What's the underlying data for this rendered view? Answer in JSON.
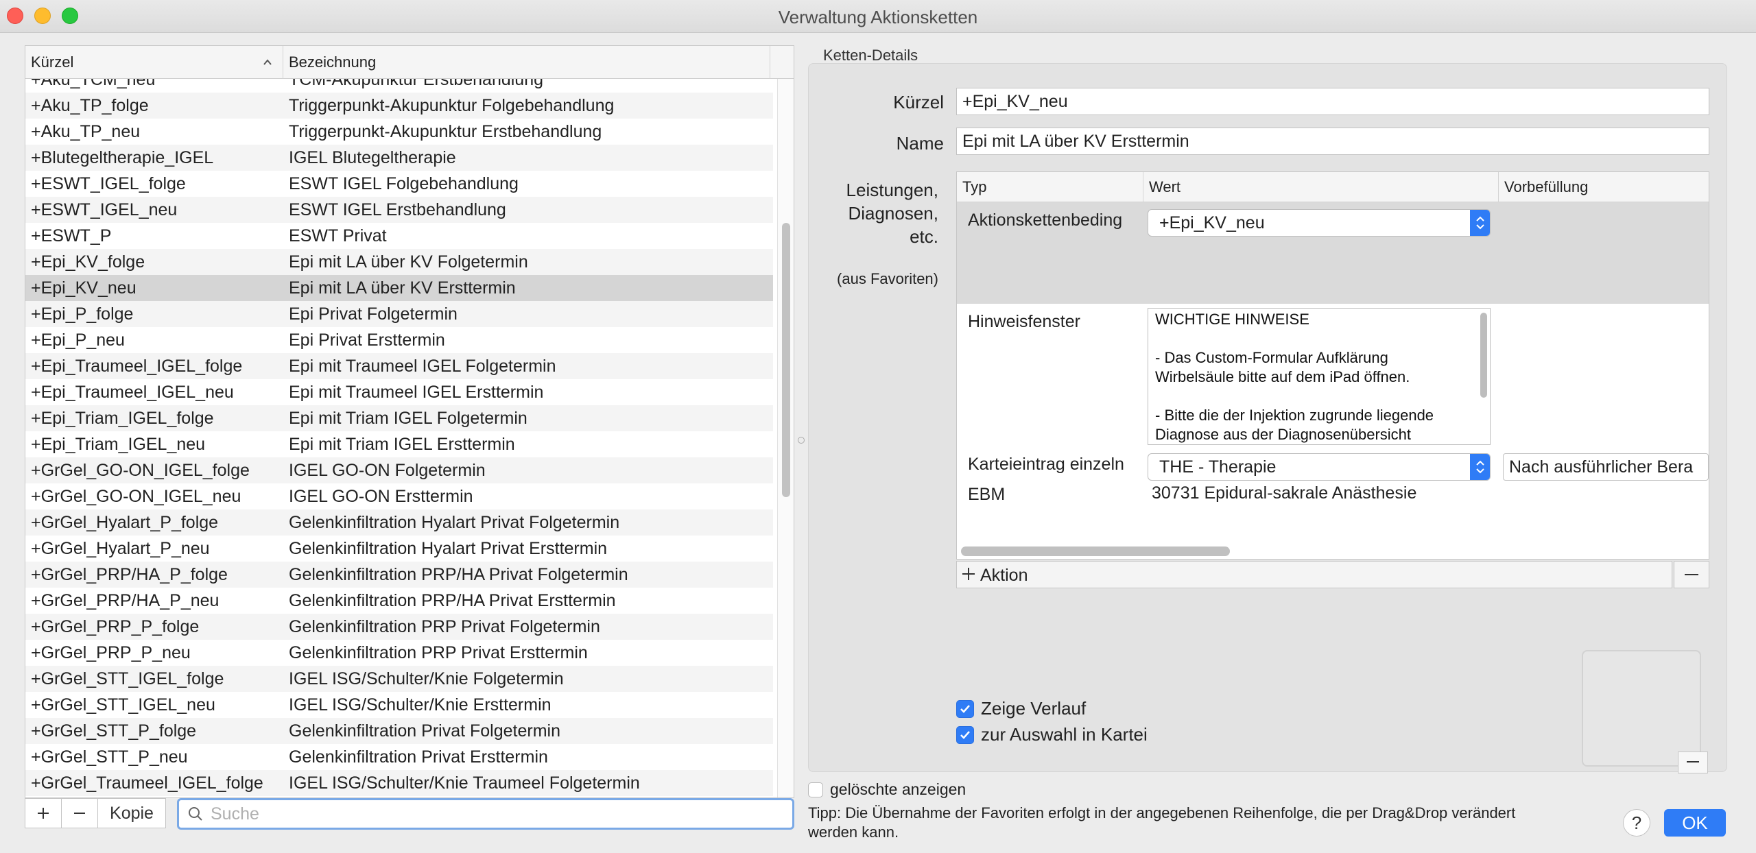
{
  "window": {
    "title": "Verwaltung Aktionsketten"
  },
  "table": {
    "col_kuerzel": "Kürzel",
    "col_bezeichnung": "Bezeichnung",
    "rows": [
      {
        "k": "+Aku_TCM_neu",
        "b": "TCM-Akupunktur Erstbehandlung"
      },
      {
        "k": "+Aku_TP_folge",
        "b": "Triggerpunkt-Akupunktur Folgebehandlung"
      },
      {
        "k": "+Aku_TP_neu",
        "b": "Triggerpunkt-Akupunktur Erstbehandlung"
      },
      {
        "k": "+Blutegeltherapie_IGEL",
        "b": "IGEL Blutegeltherapie"
      },
      {
        "k": "+ESWT_IGEL_folge",
        "b": "ESWT IGEL Folgebehandlung"
      },
      {
        "k": "+ESWT_IGEL_neu",
        "b": "ESWT IGEL Erstbehandlung"
      },
      {
        "k": "+ESWT_P",
        "b": "ESWT Privat"
      },
      {
        "k": "+Epi_KV_folge",
        "b": "Epi mit LA über KV Folgetermin"
      },
      {
        "k": "+Epi_KV_neu",
        "b": "Epi mit LA über KV Ersttermin",
        "selected": true
      },
      {
        "k": "+Epi_P_folge",
        "b": "Epi Privat Folgetermin"
      },
      {
        "k": "+Epi_P_neu",
        "b": "Epi Privat Ersttermin"
      },
      {
        "k": "+Epi_Traumeel_IGEL_folge",
        "b": "Epi mit Traumeel IGEL Folgetermin"
      },
      {
        "k": "+Epi_Traumeel_IGEL_neu",
        "b": "Epi mit Traumeel IGEL Ersttermin"
      },
      {
        "k": "+Epi_Triam_IGEL_folge",
        "b": "Epi mit Triam IGEL Folgetermin"
      },
      {
        "k": "+Epi_Triam_IGEL_neu",
        "b": "Epi mit Triam IGEL Ersttermin"
      },
      {
        "k": "+GrGel_GO-ON_IGEL_folge",
        "b": "IGEL GO-ON Folgetermin"
      },
      {
        "k": "+GrGel_GO-ON_IGEL_neu",
        "b": "IGEL GO-ON Ersttermin"
      },
      {
        "k": "+GrGel_Hyalart_P_folge",
        "b": "Gelenkinfiltration Hyalart Privat Folgetermin"
      },
      {
        "k": "+GrGel_Hyalart_P_neu",
        "b": "Gelenkinfiltration Hyalart Privat Ersttermin"
      },
      {
        "k": "+GrGel_PRP/HA_P_folge",
        "b": "Gelenkinfiltration PRP/HA Privat Folgetermin"
      },
      {
        "k": "+GrGel_PRP/HA_P_neu",
        "b": "Gelenkinfiltration PRP/HA Privat Ersttermin"
      },
      {
        "k": "+GrGel_PRP_P_folge",
        "b": "Gelenkinfiltration PRP Privat Folgetermin"
      },
      {
        "k": "+GrGel_PRP_P_neu",
        "b": "Gelenkinfiltration PRP Privat Ersttermin"
      },
      {
        "k": "+GrGel_STT_IGEL_folge",
        "b": "IGEL ISG/Schulter/Knie Folgetermin"
      },
      {
        "k": "+GrGel_STT_IGEL_neu",
        "b": "IGEL ISG/Schulter/Knie Ersttermin"
      },
      {
        "k": "+GrGel_STT_P_folge",
        "b": "Gelenkinfiltration Privat Folgetermin"
      },
      {
        "k": "+GrGel_STT_P_neu",
        "b": "Gelenkinfiltration Privat Ersttermin"
      },
      {
        "k": "+GrGel_Traumeel_IGEL_folge",
        "b": "IGEL ISG/Schulter/Knie Traumeel Folgetermin"
      }
    ]
  },
  "left_toolbar": {
    "add_label": "+",
    "remove_label": "—",
    "copy_label": "Kopie",
    "search_placeholder": "Suche",
    "search_value": ""
  },
  "details": {
    "group_title": "Ketten-Details",
    "kuerzel_label": "Kürzel",
    "kuerzel_value": "+Epi_KV_neu",
    "name_label": "Name",
    "name_value": "Epi mit LA über KV Ersttermin",
    "leistungen_label_1": "Leistungen,",
    "leistungen_label_2": "Diagnosen,",
    "leistungen_label_3": "etc.",
    "favoriten_label": "(aus Favoriten)",
    "inner": {
      "col_typ": "Typ",
      "col_wert": "Wert",
      "col_vorbefuellung": "Vorbefüllung",
      "row1_typ": "Aktionskettenbeding",
      "row1_wert": "+Epi_KV_neu",
      "row2_typ": "Hinweisfenster",
      "row2_lines": [
        "WICHTIGE HINWEISE",
        "",
        "- Das Custom-Formular Aufklärung",
        "Wirbelsäule bitte auf dem iPad öffnen.",
        "",
        "- Bitte die der Injektion zugrunde liegende",
        "Diagnose aus der Diagnosenübersicht"
      ],
      "row3_typ": "Karteieintrag einzeln",
      "row3_wert": "THE - Therapie",
      "row3_vorbefuellung": "Nach ausführlicher Bera",
      "row4_typ": "EBM",
      "row4_wert": "30731 Epidural-sakrale Anästhesie"
    },
    "aktion_label": "Aktion",
    "zeige_verlauf": "Zeige Verlauf",
    "zeige_verlauf_checked": true,
    "zur_auswahl": "zur Auswahl in Kartei",
    "zur_auswahl_checked": true
  },
  "footer": {
    "geloeschte_anzeigen": "gelöschte anzeigen",
    "geloeschte_checked": false,
    "tip_line_1": "Tipp: Die Übernahme der Favoriten erfolgt in der angegebenen Reihenfolge, die per Drag&Drop verändert",
    "tip_line_2": "werden kann.",
    "help_label": "?",
    "ok_label": "OK"
  },
  "colors": {
    "accent": "#2f7cf6",
    "selected_row": "#d5d5d5"
  }
}
